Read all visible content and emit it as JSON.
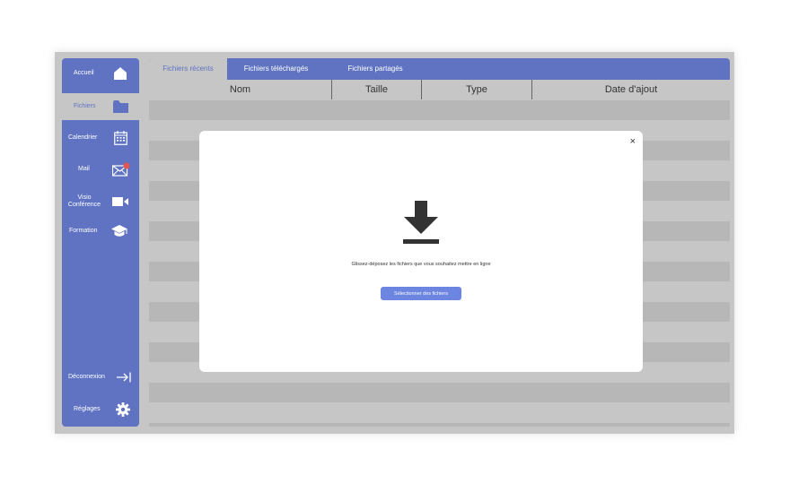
{
  "sidebar": {
    "items": [
      {
        "label": "Accueil",
        "icon": "home-icon"
      },
      {
        "label": "Fichiers",
        "icon": "folder-icon"
      },
      {
        "label": "Calendrier",
        "icon": "calendar-icon"
      },
      {
        "label": "Mail",
        "icon": "mail-icon"
      },
      {
        "label": "Visio\nConférence",
        "icon": "video-camera-icon"
      },
      {
        "label": "Formation",
        "icon": "graduation-cap-icon"
      }
    ],
    "logout_label": "Déconnexion",
    "settings_label": "Réglages"
  },
  "tabs": [
    "Fichiers récents",
    "Fichiers téléchargés",
    "Fichiers partagés"
  ],
  "table": {
    "columns": [
      "Nom",
      "Taille",
      "Type",
      "Date d'ajout"
    ]
  },
  "modal": {
    "close_label": "×",
    "dropzone_text": "Glissez-déposez les fichiers que vous souhaitez mettre en ligne",
    "select_button_label": "Sélectionner des fichiers"
  },
  "colors": {
    "primary": "#5f73c2",
    "button": "#6c85e0",
    "background": "#c6c6c6",
    "row_stripe": "#b7b7b7",
    "notification_dot": "#e25555"
  }
}
